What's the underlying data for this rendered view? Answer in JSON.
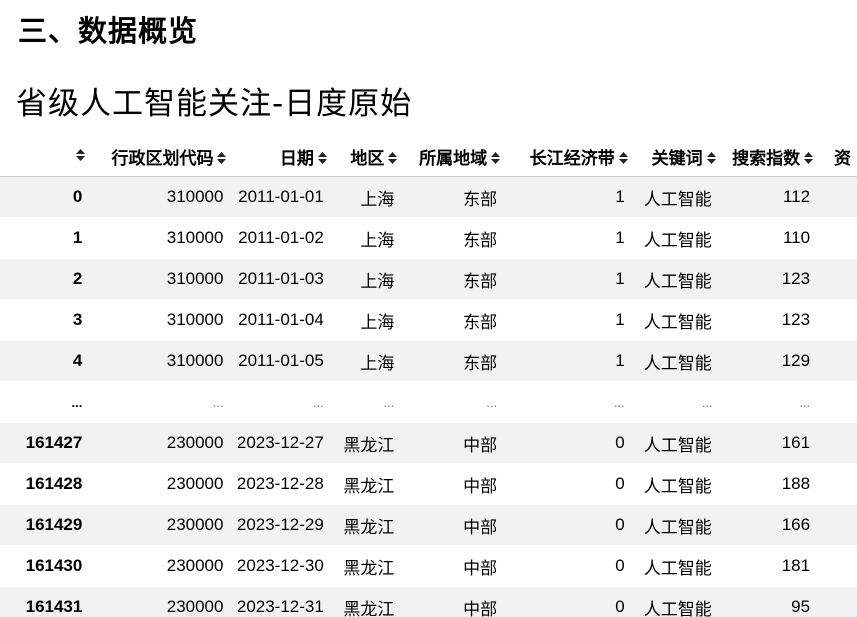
{
  "section_title": "三、数据概览",
  "table_title": "省级人工智能关注-日度原始",
  "columns": [
    "",
    "行政区划代码",
    "日期",
    "地区",
    "所属地域",
    "长江经济带",
    "关键词",
    "搜索指数",
    "资"
  ],
  "sort_icon": "sort-updown-icon",
  "rows": [
    [
      "0",
      "310000",
      "2011-01-01",
      "上海",
      "东部",
      "1",
      "人工智能",
      "112",
      ""
    ],
    [
      "1",
      "310000",
      "2011-01-02",
      "上海",
      "东部",
      "1",
      "人工智能",
      "110",
      ""
    ],
    [
      "2",
      "310000",
      "2011-01-03",
      "上海",
      "东部",
      "1",
      "人工智能",
      "123",
      ""
    ],
    [
      "3",
      "310000",
      "2011-01-04",
      "上海",
      "东部",
      "1",
      "人工智能",
      "123",
      ""
    ],
    [
      "4",
      "310000",
      "2011-01-05",
      "上海",
      "东部",
      "1",
      "人工智能",
      "129",
      ""
    ],
    [
      "...",
      "...",
      "...",
      "...",
      "...",
      "...",
      "...",
      "...",
      ""
    ],
    [
      "161427",
      "230000",
      "2023-12-27",
      "黑龙江",
      "中部",
      "0",
      "人工智能",
      "161",
      ""
    ],
    [
      "161428",
      "230000",
      "2023-12-28",
      "黑龙江",
      "中部",
      "0",
      "人工智能",
      "188",
      ""
    ],
    [
      "161429",
      "230000",
      "2023-12-29",
      "黑龙江",
      "中部",
      "0",
      "人工智能",
      "166",
      ""
    ],
    [
      "161430",
      "230000",
      "2023-12-30",
      "黑龙江",
      "中部",
      "0",
      "人工智能",
      "181",
      ""
    ],
    [
      "161431",
      "230000",
      "2023-12-31",
      "黑龙江",
      "中部",
      "0",
      "人工智能",
      "95",
      ""
    ]
  ],
  "colors": {
    "stripe": "#f2f2f2",
    "header_border": "#c8c8c8"
  }
}
